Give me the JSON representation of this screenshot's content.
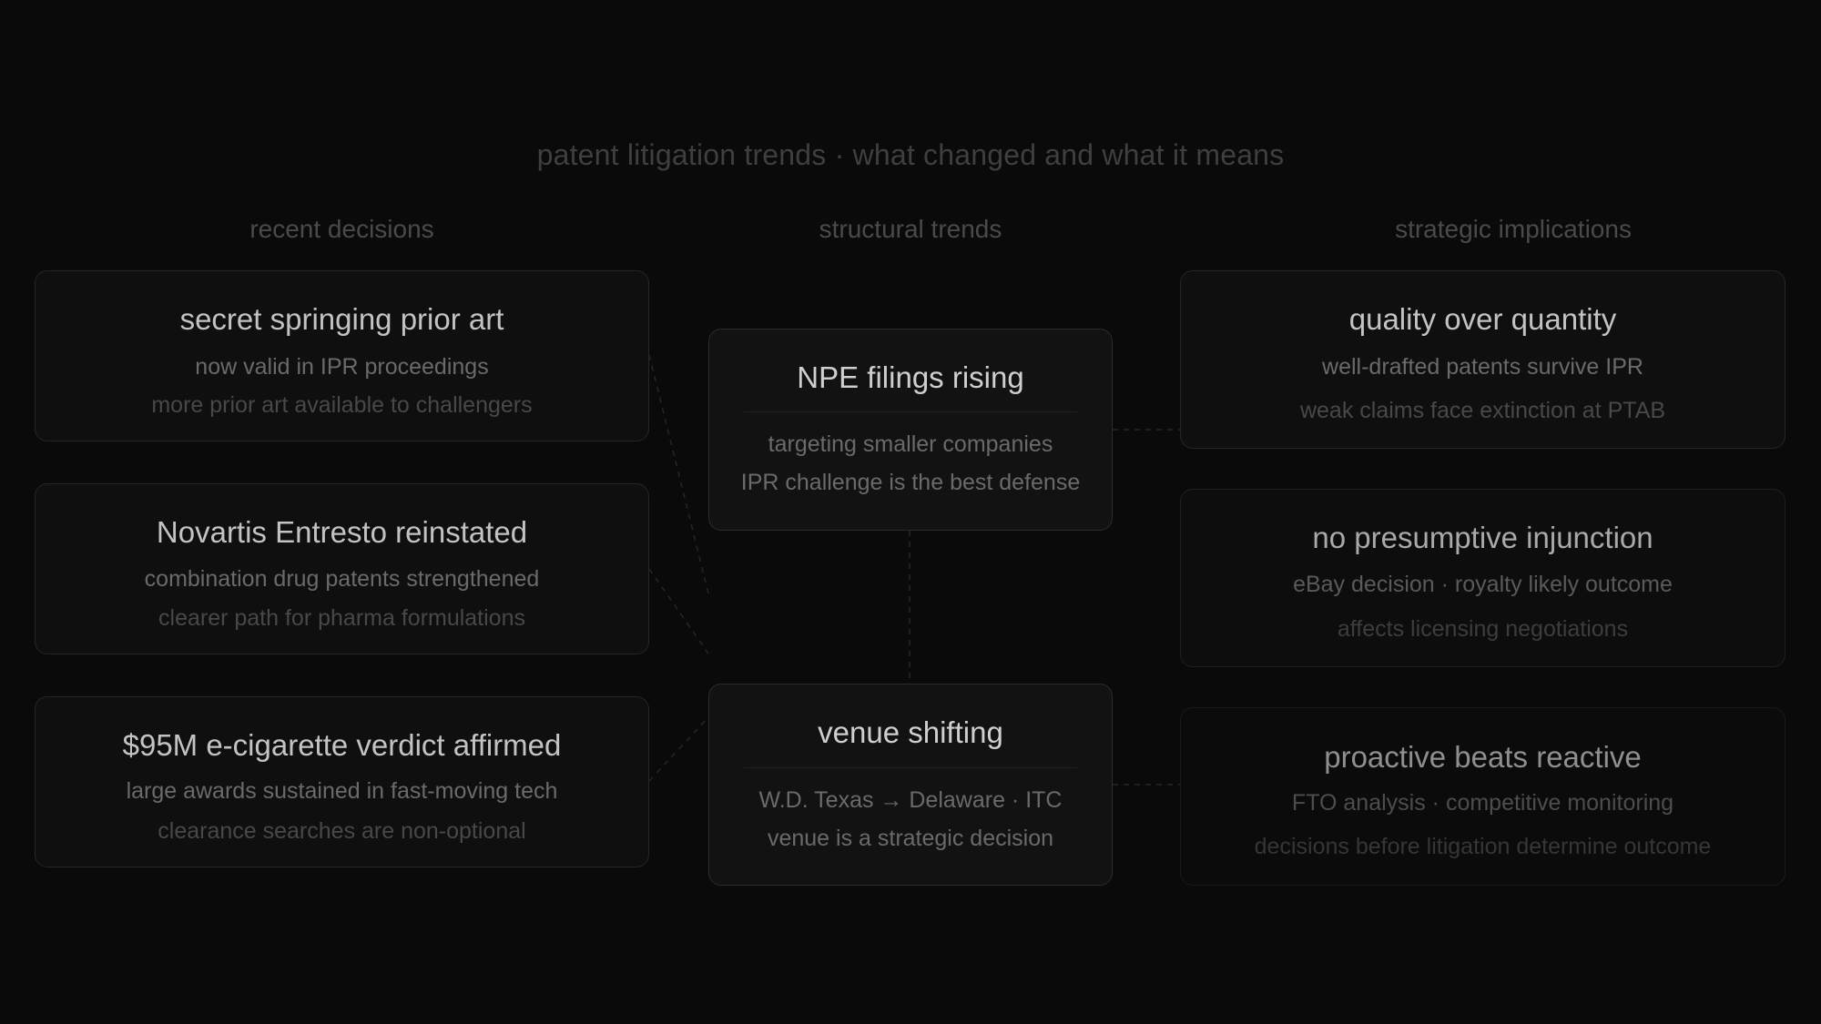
{
  "title": "patent litigation trends · what changed and what it means",
  "columns": {
    "left": "recent decisions",
    "center": "structural trends",
    "right": "strategic implications"
  },
  "decisions": [
    {
      "title": "secret springing prior art",
      "line1": "now valid in IPR proceedings",
      "line2": "more prior art available to challengers"
    },
    {
      "title": "Novartis Entresto reinstated",
      "line1": "combination drug patents strengthened",
      "line2": "clearer path for pharma formulations"
    },
    {
      "title": "$95M e-cigarette verdict affirmed",
      "line1": "large awards sustained in fast-moving tech",
      "line2": "clearance searches are non-optional"
    }
  ],
  "trends": [
    {
      "title": "NPE filings rising",
      "line1": "targeting smaller companies",
      "line2": "IPR challenge is the best defense"
    },
    {
      "title": "venue shifting",
      "line1": "W.D. Texas → Delaware · ITC",
      "line2": "venue is a strategic decision"
    }
  ],
  "implications": [
    {
      "title": "quality over quantity",
      "line1": "well-drafted patents survive IPR",
      "line2": "weak claims face extinction at PTAB"
    },
    {
      "title": "no presumptive injunction",
      "line1": "eBay decision · royalty likely outcome",
      "line2": "affects licensing negotiations"
    },
    {
      "title": "proactive beats reactive",
      "line1": "FTO analysis · competitive monitoring",
      "line2": "decisions before litigation determine outcome"
    }
  ]
}
